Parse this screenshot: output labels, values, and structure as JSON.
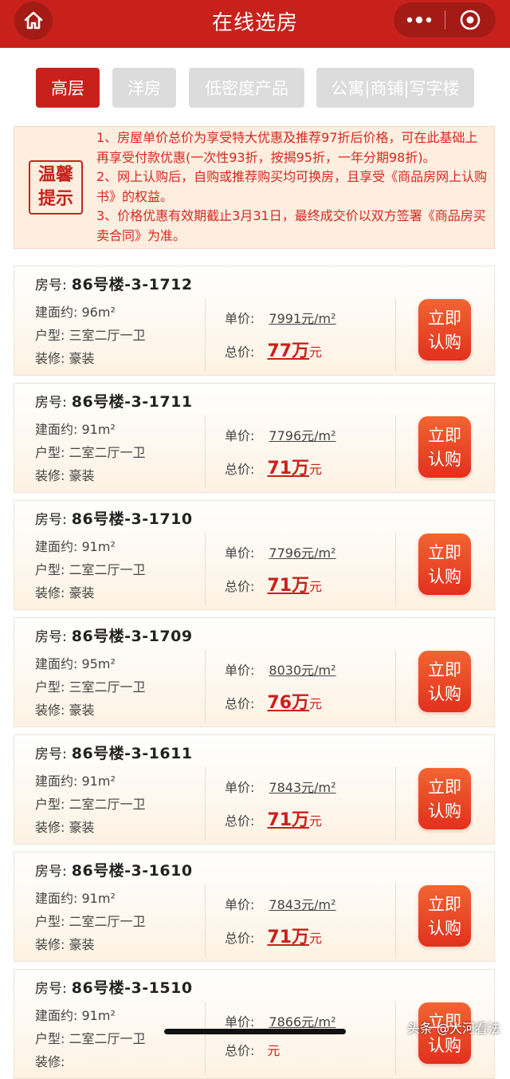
{
  "header": {
    "title": "在线选房",
    "home_icon": "home-icon",
    "more_icon": "more-dots-icon",
    "target_icon": "target-icon"
  },
  "tabs": [
    {
      "label": "高层",
      "active": true
    },
    {
      "label": "洋房",
      "active": false
    },
    {
      "label": "低密度产品",
      "active": false
    },
    {
      "label": "公寓|商铺|写字楼",
      "active": false
    }
  ],
  "notice": {
    "badge_line1": "温馨",
    "badge_line2": "提示",
    "lines": [
      "1、房屋单价总价为享受特大优惠及推荐97折后价格，可在此基础上再享受付款优惠(一次性93折，按揭95折，一年分期98折)。",
      "2、网上认购后，自购或推荐购买均可换房，且享受《商品房网上认购书》的权益。",
      "3、价格优惠有效期截止3月31日，最终成交价以双方签署《商品房买卖合同》为准。"
    ]
  },
  "labels": {
    "room": "房号:",
    "area": "建面约:",
    "layout": "户型:",
    "decor": "装修:",
    "unit_price": "单价:",
    "total_price": "总价:",
    "unit_suffix": "元/m²",
    "total_suffix": "元",
    "buy_line1": "立即",
    "buy_line2": "认购"
  },
  "listings": [
    {
      "room": "86号楼-3-1712",
      "area": "96m²",
      "layout": "三室二厅一卫",
      "decor": "豪装",
      "unit_price": "7991",
      "total_price": "77万"
    },
    {
      "room": "86号楼-3-1711",
      "area": "91m²",
      "layout": "二室二厅一卫",
      "decor": "豪装",
      "unit_price": "7796",
      "total_price": "71万"
    },
    {
      "room": "86号楼-3-1710",
      "area": "91m²",
      "layout": "二室二厅一卫",
      "decor": "豪装",
      "unit_price": "7796",
      "total_price": "71万"
    },
    {
      "room": "86号楼-3-1709",
      "area": "95m²",
      "layout": "三室二厅一卫",
      "decor": "豪装",
      "unit_price": "8030",
      "total_price": "76万"
    },
    {
      "room": "86号楼-3-1611",
      "area": "91m²",
      "layout": "二室二厅一卫",
      "decor": "豪装",
      "unit_price": "7843",
      "total_price": "71万"
    },
    {
      "room": "86号楼-3-1610",
      "area": "91m²",
      "layout": "二室二厅一卫",
      "decor": "豪装",
      "unit_price": "7843",
      "total_price": "71万"
    },
    {
      "room": "86号楼-3-1510",
      "area": "91m²",
      "layout": "二室二厅一卫",
      "decor": "",
      "unit_price": "7866",
      "total_price": ""
    }
  ],
  "watermark": "头条 @大河看法",
  "colors": {
    "brand_red": "#c8211c",
    "notice_red": "#d8281f",
    "button_orange": "#f26432"
  }
}
